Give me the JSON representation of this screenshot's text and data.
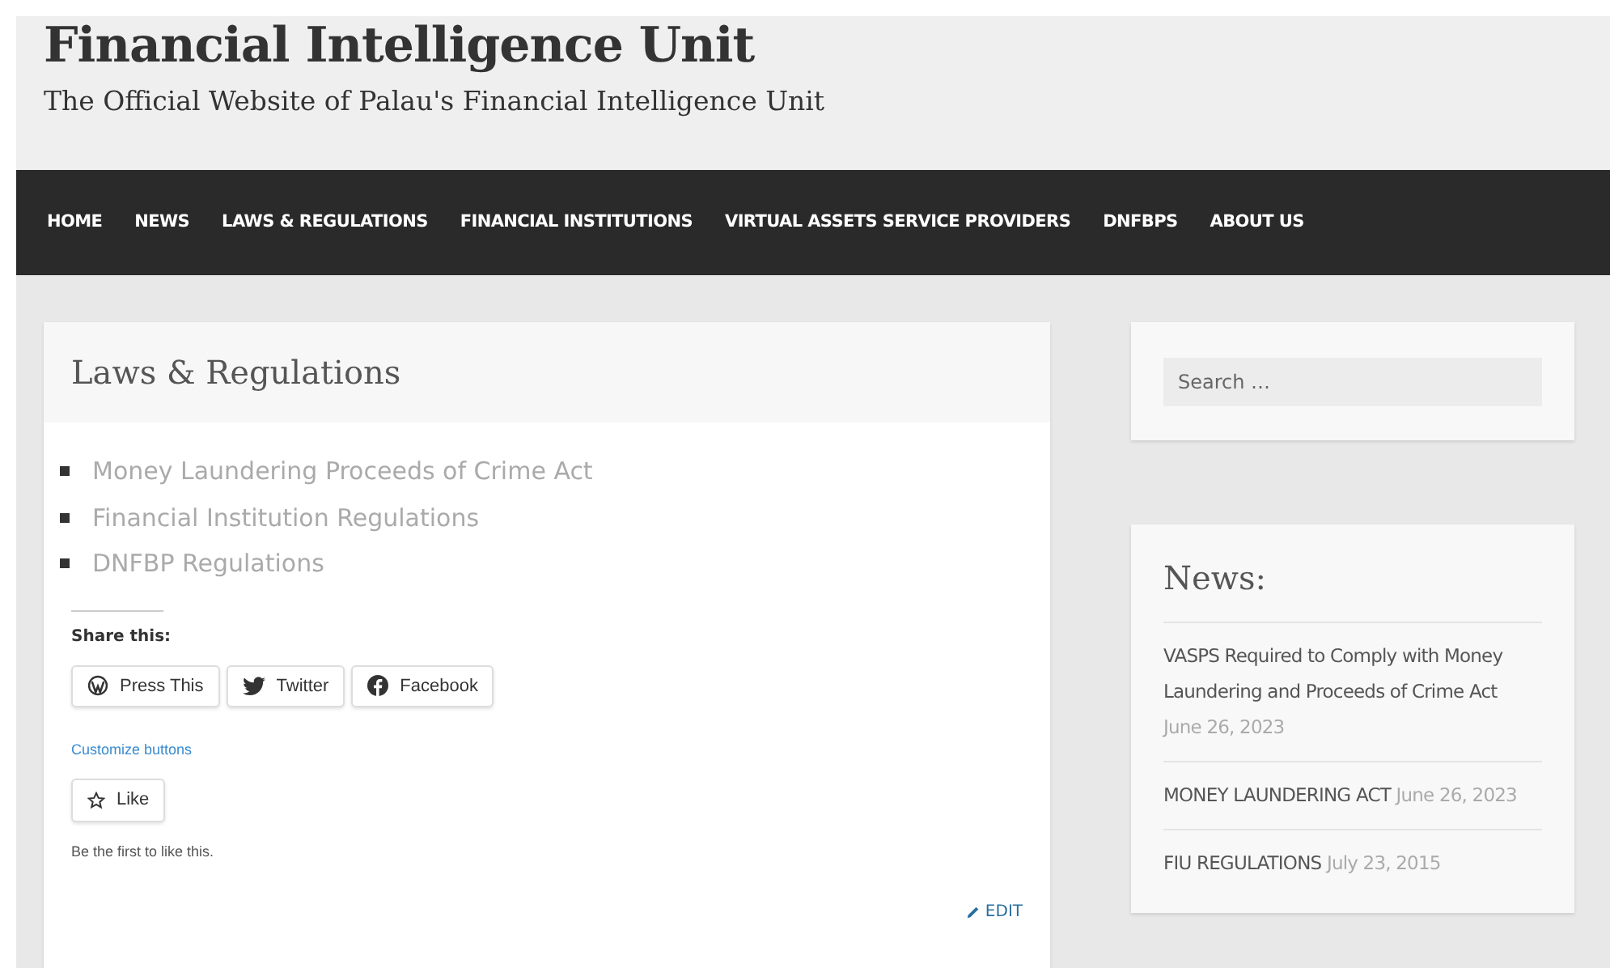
{
  "site": {
    "title": "Financial Intelligence Unit",
    "tagline": "The Official Website of Palau's Financial Intelligence Unit"
  },
  "nav": [
    "HOME",
    "NEWS",
    "LAWS & REGULATIONS",
    "FINANCIAL INSTITUTIONS",
    "VIRTUAL ASSETS SERVICE PROVIDERS",
    "DNFBPS",
    "ABOUT US"
  ],
  "page": {
    "title": "Laws & Regulations",
    "links": [
      "Money Laundering Proceeds of Crime Act",
      "Financial Institution Regulations",
      "DNFBP Regulations"
    ],
    "share_heading": "Share this:",
    "share_buttons": [
      {
        "kind": "wordpress",
        "label": "Press This"
      },
      {
        "kind": "twitter",
        "label": "Twitter"
      },
      {
        "kind": "facebook",
        "label": "Facebook"
      }
    ],
    "customize": "Customize buttons",
    "like_button": "Like",
    "like_note": "Be the first to like this.",
    "edit": "EDIT"
  },
  "search": {
    "placeholder": "Search …"
  },
  "news": {
    "title": "News:",
    "items": [
      {
        "title": "VASPS Required to Comply with Money Laundering and Proceeds of Crime Act",
        "date": "June 26, 2023"
      },
      {
        "title": "MONEY LAUNDERING ACT",
        "date": "June 26, 2023"
      },
      {
        "title": "FIU REGULATIONS",
        "date": "July 23, 2015"
      }
    ]
  }
}
